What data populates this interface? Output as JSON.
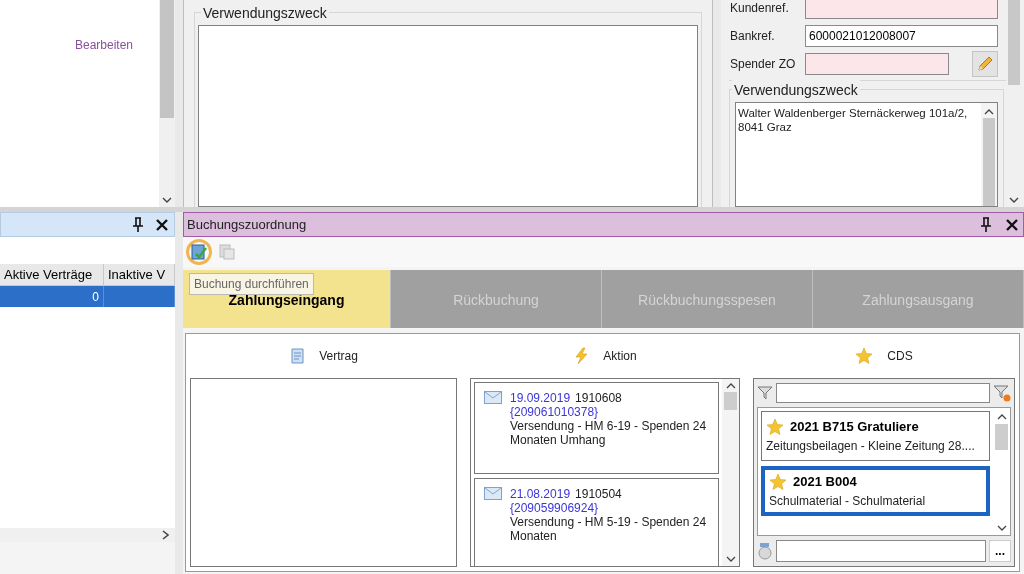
{
  "left_top": {
    "link": "Bearbeiten"
  },
  "middle_top": {
    "group_title": "Verwendungszweck"
  },
  "right_top": {
    "fields": [
      {
        "label": "Kundenref.",
        "required": true
      },
      {
        "label": "Bankref.",
        "value": "6000021012008007",
        "required": false
      },
      {
        "label": "Spender ZO",
        "required": true,
        "kind": "edit"
      }
    ],
    "group_title": "Verwendungszweck",
    "text": "Walter Waldenberger Sternäckerweg 101a/2,\n8041 Graz"
  },
  "left_pane": {
    "columns": [
      "Aktive Verträge",
      "Inaktive V"
    ],
    "rows": [
      {
        "cells": [
          "0",
          ""
        ],
        "selected": true
      }
    ]
  },
  "right_pane": {
    "title": "Buchungszuordnung",
    "tooltip": "Buchung durchführen",
    "tabs": [
      {
        "label": "Zahlungseingang",
        "selected": true
      },
      {
        "label": "Rückbuchung",
        "selected": false
      },
      {
        "label": "Rückbuchungsspesen",
        "selected": false
      },
      {
        "label": "Zahlungsausgang",
        "selected": false
      }
    ],
    "columns": [
      "Vertrag",
      "Aktion",
      "CDS"
    ],
    "actions": [
      {
        "date": "19.09.2019",
        "number": "1910608",
        "ref": "{209061010378}",
        "text": "Versendung - HM 6-19 - Spenden 24 Monaten Umhang"
      },
      {
        "date": "21.08.2019",
        "number": "1910504",
        "ref": "{209059906924}",
        "text": "Versendung - HM 5-19 - Spenden 24 Monaten"
      }
    ],
    "cds": [
      {
        "title": "2021 B715 Gratuliere",
        "text": "Zeitungsbeilagen - Kleine Zeitung 28....",
        "selected": false
      },
      {
        "title": "2021 B004",
        "text": "Schulmaterial - Schulmaterial",
        "selected": true
      }
    ],
    "more_button": "..."
  }
}
